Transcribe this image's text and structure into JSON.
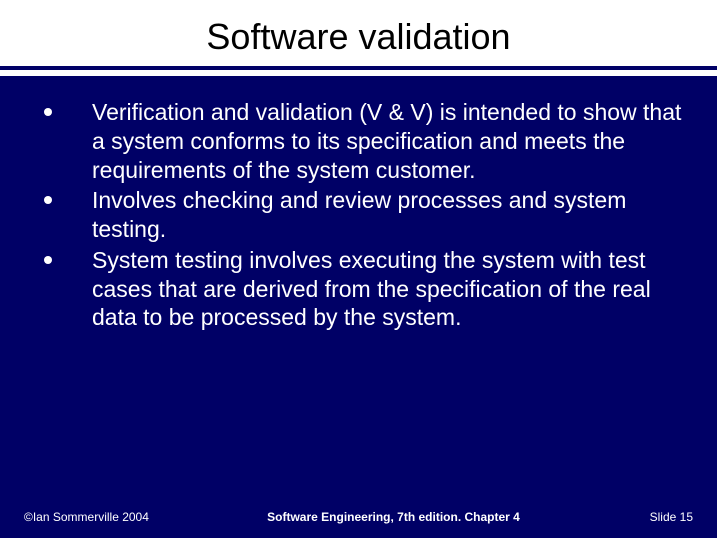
{
  "title": "Software validation",
  "bullets": [
    "Verification and validation (V & V) is intended to show that a system conforms to its specification and meets the requirements of the system customer.",
    "Involves checking and review processes and system testing.",
    "System testing involves executing the system with test cases that are derived from the specification of the real data to be processed by the system."
  ],
  "footer": {
    "left": "©Ian Sommerville 2004",
    "center": "Software Engineering, 7th edition. Chapter 4",
    "right": "Slide 15"
  }
}
